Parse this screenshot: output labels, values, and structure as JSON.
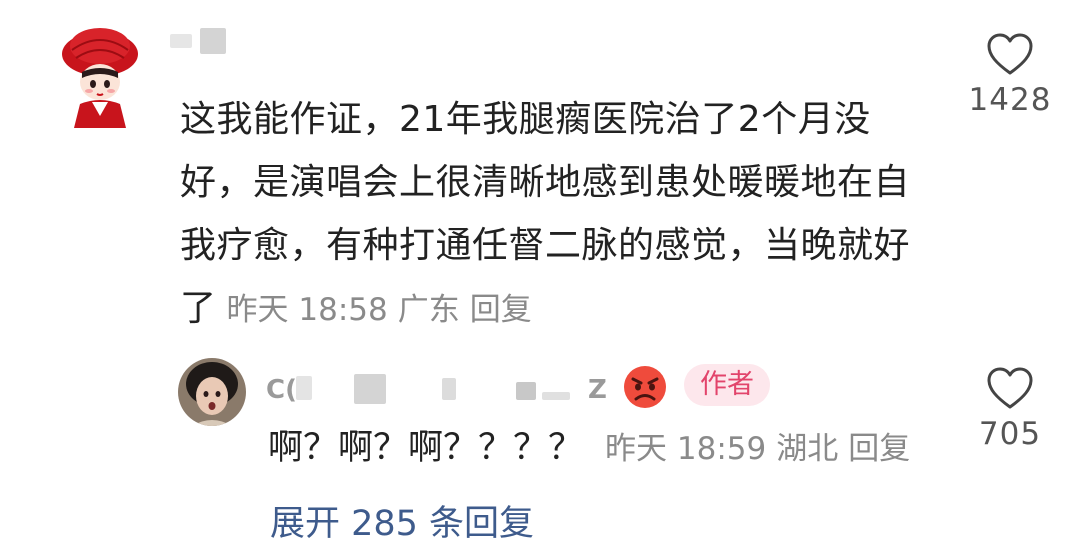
{
  "main_comment": {
    "text": "这我能作证，21年我腿瘸医院治了2个月没好，是演唱会上很清晰地感到患处暖暖地在自我疗愈，有种打通任督二脉的感觉，当晚就好了",
    "time": "昨天 18:58",
    "location": "广东",
    "reply_label": "回复",
    "likes": "1428"
  },
  "reply_comment": {
    "username_visible_start": "C(",
    "username_visible_end": "Z",
    "author_badge": "作者",
    "text": "啊？啊？啊？？？？",
    "time": "昨天 18:59",
    "location": "湖北",
    "reply_label": "回复",
    "likes": "705"
  },
  "expand_replies": "展开 285 条回复",
  "colors": {
    "text": "#222222",
    "meta": "#8a8a8a",
    "badge_bg": "#fde7ec",
    "badge_text": "#e2446b",
    "link": "#3e5b8c",
    "avatar_red": "#c8141c"
  },
  "icons": {
    "like": "heart-outline-icon",
    "emoji": "angry-face-emoji"
  }
}
